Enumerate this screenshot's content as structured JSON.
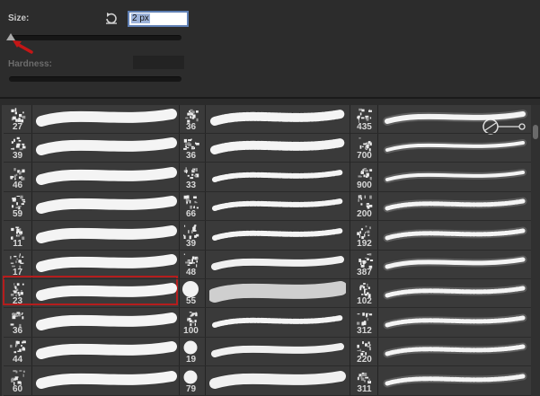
{
  "size": {
    "label": "Size:",
    "value": "2 px",
    "slider_fraction": 0.0
  },
  "hardness": {
    "label": "Hardness:"
  },
  "icons": {
    "reset": "reset-arrow-icon",
    "annotation": "red-arrow-icon",
    "lasso": "lasso-toggle-icon"
  },
  "colors": {
    "highlight": "#b51d1d",
    "field_border": "#5f7fb3"
  },
  "brushes": {
    "col1": [
      "27",
      "39",
      "46",
      "59",
      "11",
      "17",
      "23",
      "36",
      "44",
      "60"
    ],
    "col2": [
      "36",
      "36",
      "33",
      "66",
      "39",
      "48",
      "55",
      "100",
      "19",
      "79"
    ],
    "col3": [
      "435",
      "700",
      "900",
      "200",
      "192",
      "387",
      "102",
      "312",
      "220",
      "311"
    ]
  },
  "selected_brush": "23"
}
